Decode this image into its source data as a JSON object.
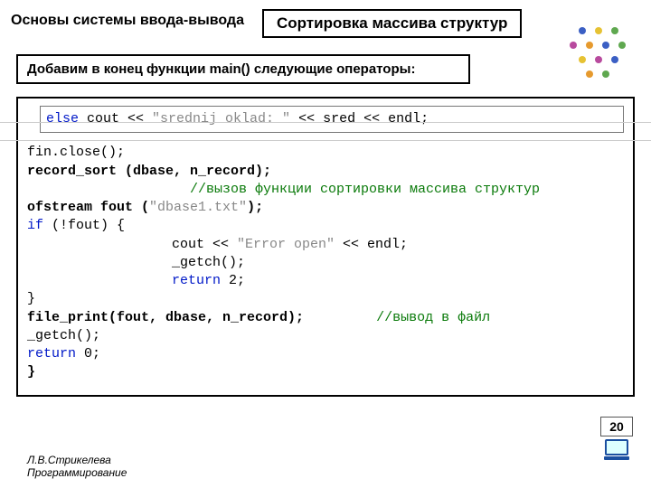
{
  "header": {
    "left": "Основы системы ввода-вывода",
    "box": "Сортировка массива структур"
  },
  "subhead": "Добавим в конец функции main() следующие операторы:",
  "code": {
    "line1_a": "else",
    "line1_b": " cout << ",
    "line1_c": "\"srednij oklad:  \"",
    "line1_d": " << sred << endl;",
    "l2": "fin.close();",
    "l3": "record_sort (dbase, n_record);",
    "l4": "//вызов функции сортировки массива структур",
    "l5a": "ofstream fout (",
    "l5b": "\"dbase1.txt\"",
    "l5c": ");",
    "l6a": "if",
    "l6b": " (!fout) {",
    "l7a": "cout << ",
    "l7b": "\"Error open\"",
    "l7c": " << endl;",
    "l8": "_getch();",
    "l9a": "return",
    "l9b": " 2;",
    "l10": "}",
    "l11a": "file_print(fout, dbase, n_record);",
    "l11b": "//вывод в файл",
    "l12": "_getch();",
    "l13a": "return",
    "l13b": " 0;",
    "l14": "}"
  },
  "footer": {
    "l1": "Л.В.Стрикелева",
    "l2": "Программирование"
  },
  "page": "20",
  "dot_colors": [
    "#3b5fc4",
    "#e6c233",
    "#5fa84f",
    "#b84a9e",
    "#e69a2e",
    "#3b5fc4",
    "#5fa84f",
    "#e6c233",
    "#b84a9e",
    "#3b5fc4",
    "#e69a2e",
    "#5fa84f"
  ]
}
